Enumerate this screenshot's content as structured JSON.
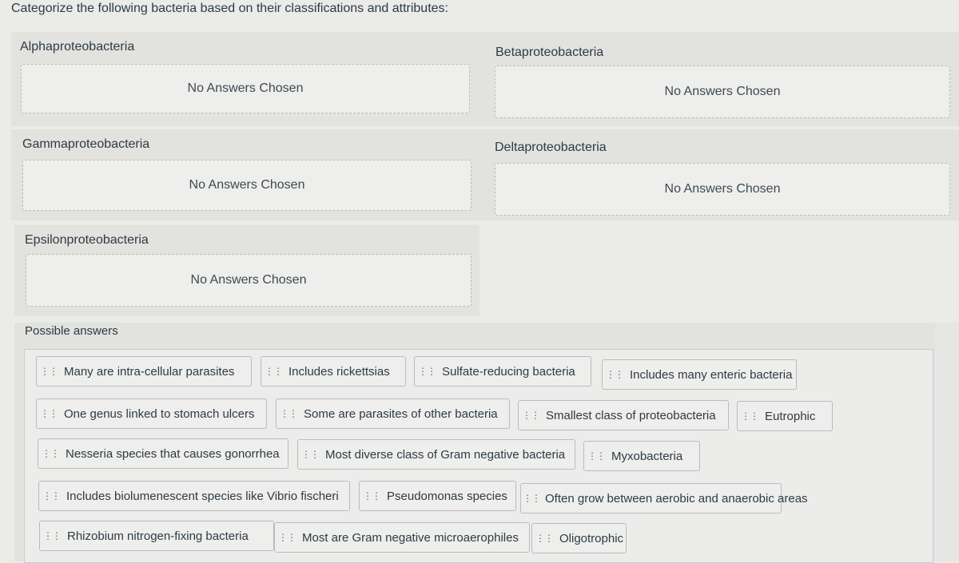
{
  "question": "Categorize the following bacteria based on their classifications and attributes:",
  "categories": [
    {
      "label": "Alphaproteobacteria",
      "placeholder": "No Answers Chosen"
    },
    {
      "label": "Betaproteobacteria",
      "placeholder": "No Answers Chosen"
    },
    {
      "label": "Gammaproteobacteria",
      "placeholder": "No Answers Chosen"
    },
    {
      "label": "Deltaproteobacteria",
      "placeholder": "No Answers Chosen"
    },
    {
      "label": "Epsilonproteobacteria",
      "placeholder": "No Answers Chosen"
    }
  ],
  "possible_answers_label": "Possible answers",
  "drag_handle_icon": "⋮⋮",
  "answers": [
    "Many are intra-cellular parasites",
    "Includes rickettsias",
    "Sulfate-reducing bacteria",
    "Includes many enteric bacteria",
    "One genus linked to stomach ulcers",
    "Some are parasites of other bacteria",
    "Smallest class of proteobacteria",
    "Eutrophic",
    "Nesseria species that causes gonorrhea",
    "Most diverse class of Gram negative bacteria",
    "Myxobacteria",
    "Includes biolumenescent species like Vibrio fischeri",
    "Pseudomonas species",
    "Often grow between aerobic and anaerobic areas",
    "Rhizobium nitrogen-fixing bacteria",
    "Most are Gram negative microaerophiles",
    "Oligotrophic"
  ]
}
